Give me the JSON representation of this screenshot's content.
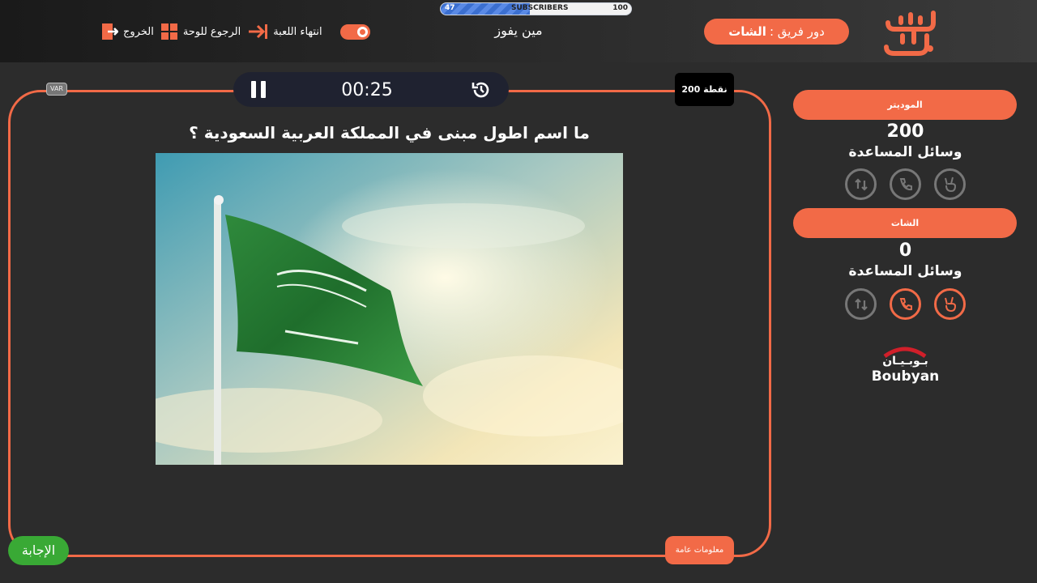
{
  "subscribers": {
    "label": "SUBSCRIBERS",
    "current": "47",
    "max": "100",
    "progress": 0.47
  },
  "header": {
    "logo_text": "سين جيم",
    "turn_prefix": "دور فريق :",
    "turn_team": "الشات",
    "title": "مين يفوز",
    "actions": {
      "end_game": "انتهاء اللعبة",
      "back_to_board": "الرجوع للوحة",
      "exit": "الخروج"
    }
  },
  "board": {
    "var_label": "VAR",
    "timer": "00:25",
    "points": "200 نقطة",
    "question": "ما اسم اطول مبنى في المملكة العربية السعودية ؟",
    "category": "معلومات عامة",
    "answer_label": "الإجابة"
  },
  "teams": [
    {
      "name": "الموديتر",
      "score": "200",
      "aids_label": "وسائل المساعدة"
    },
    {
      "name": "الشات",
      "score": "0",
      "aids_label": "وسائل المساعدة"
    }
  ],
  "sponsor": {
    "ar": "بـوبـيـان",
    "en": "Boubyan"
  },
  "colors": {
    "accent": "#f26a47",
    "answer": "#39a935",
    "background": "#2c2c2c"
  }
}
